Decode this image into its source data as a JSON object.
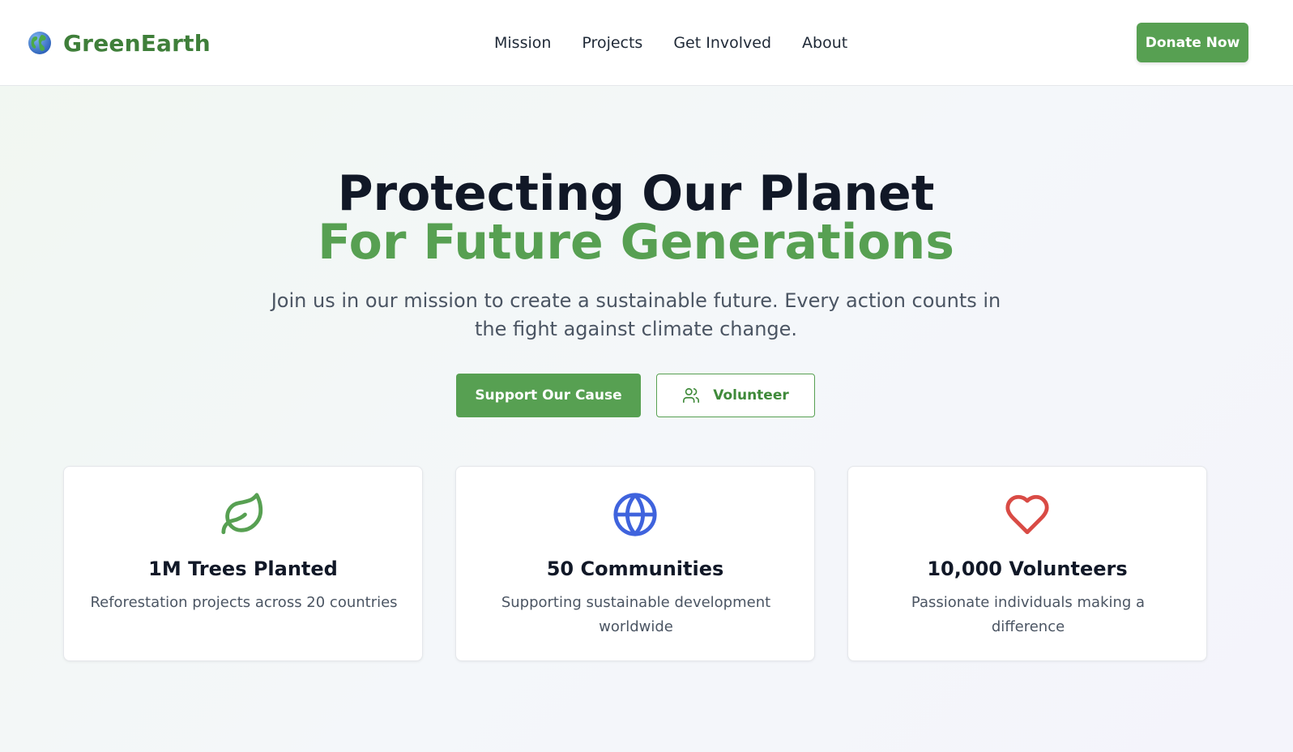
{
  "brand": {
    "name": "GreenEarth",
    "icon": "globe-icon"
  },
  "nav": {
    "items": [
      "Mission",
      "Projects",
      "Get Involved",
      "About"
    ]
  },
  "header": {
    "donate_label": "Donate Now"
  },
  "hero": {
    "title_line1": "Protecting Our Planet",
    "title_line2": "For Future Generations",
    "subtitle": "Join us in our mission to create a sustainable future. Every action counts in the fight against climate change.",
    "primary_label": "Support Our Cause",
    "secondary_label": "Volunteer",
    "secondary_icon": "users-icon"
  },
  "stats": [
    {
      "icon": "leaf-icon",
      "title": "1M Trees Planted",
      "desc": "Reforestation projects across 20 countries"
    },
    {
      "icon": "globe-outline-icon",
      "title": "50 Communities",
      "desc": "Supporting sustainable development worldwide"
    },
    {
      "icon": "heart-icon",
      "title": "10,000 Volunteers",
      "desc": "Passionate individuals making a difference"
    }
  ],
  "colors": {
    "brand_green": "#57a052",
    "dark_green": "#3f7f3a",
    "globe_blue": "#3f63dd",
    "heart_red": "#d94b45"
  }
}
